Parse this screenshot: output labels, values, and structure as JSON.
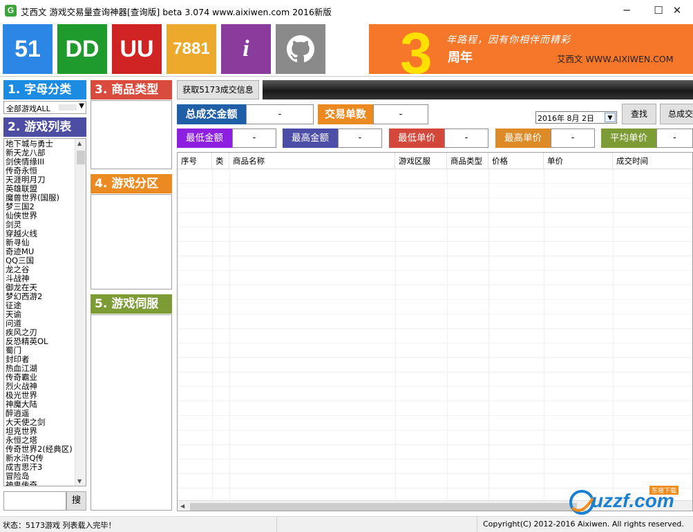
{
  "window": {
    "title": "艾西文 游戏交易量查询神器[查询版] beta 3.074 www.aixiwen.com 2016新版",
    "icon_letter": "G",
    "minimize": "─",
    "maximize": "☐",
    "close": "✕"
  },
  "logos": [
    {
      "label": "51",
      "color": "#2b86e6"
    },
    {
      "label": "DD",
      "color": "#1f9a2c"
    },
    {
      "label": "UU",
      "color": "#d02424"
    },
    {
      "label": "7881",
      "color": "#eca92b"
    },
    {
      "label": "i",
      "color": "#8a3c9c"
    },
    {
      "label": "github",
      "color": "#8a8a8a"
    }
  ],
  "banner": {
    "number": "3",
    "slogan": "年路程，因有你相伴而精彩",
    "anniversary": "周年",
    "site": "艾西文 WWW.AIXIWEN.COM"
  },
  "sections": {
    "letter_category": "1. 字母分类",
    "game_list": "2. 游戏列表",
    "goods_type": "3. 商品类型",
    "game_zone": "4. 游戏分区",
    "game_server": "5. 游戏伺服"
  },
  "letter_select": {
    "value": "全部游戏ALL"
  },
  "games": [
    "地下城与勇士",
    "新天龙八部",
    "剑侠情缘III",
    "传奇永恒",
    "天涯明月刀",
    "英雄联盟",
    "魔兽世界(国服)",
    "梦三国2",
    "仙侠世界",
    "剑灵",
    "穿越火线",
    "新寻仙",
    "奇迹MU",
    "QQ三国",
    "龙之谷",
    "斗战神",
    "御龙在天",
    "梦幻西游2",
    "征途",
    "天谕",
    "问道",
    "疾风之刃",
    "反恐精英OL",
    "蜀门",
    "封印者",
    "热血江湖",
    "传奇霸业",
    "烈火战神",
    "极光世界",
    "神魔大陆",
    "醉逍遥",
    "大天使之剑",
    "坦克世界",
    "永恒之塔",
    "传奇世界2(经典区)",
    "新水浒Q传",
    "成吉思汗3",
    "冒险岛",
    "神鬼传奇"
  ],
  "search": {
    "value": "",
    "button": "搜"
  },
  "toolbar": {
    "fetch_button": "获取5173成交信息",
    "find_button": "查找",
    "total_button": "总成交"
  },
  "date_picker": {
    "value": "2016年  8月  2日"
  },
  "stats": {
    "total_amount": {
      "label": "总成交金额",
      "value": "-",
      "color": "#1f5fa8"
    },
    "order_count": {
      "label": "交易单数",
      "value": "-",
      "color": "#ec8a22"
    },
    "min_amount": {
      "label": "最低金额",
      "value": "-",
      "color": "#8c1fe0"
    },
    "max_amount": {
      "label": "最高金额",
      "value": "-",
      "color": "#4d4ea8"
    },
    "min_price": {
      "label": "最低单价",
      "value": "-",
      "color": "#d3483b"
    },
    "max_price": {
      "label": "最高单价",
      "value": "-",
      "color": "#dc8b26"
    },
    "avg_price": {
      "label": "平均单价",
      "value": "-",
      "color": "#7d9c35"
    }
  },
  "table": {
    "columns": [
      "序号",
      "类",
      "商品名称",
      "游戏区服",
      "商品类型",
      "价格",
      "单价",
      "成交时间"
    ]
  },
  "status": {
    "left": "状态：5173游戏 列表载入完毕！",
    "right": "Copyright(C) 2012-2016 Aixiwen. All rights reserved."
  },
  "watermark": {
    "text": "uzzf.com",
    "sub": "东坡下载"
  }
}
